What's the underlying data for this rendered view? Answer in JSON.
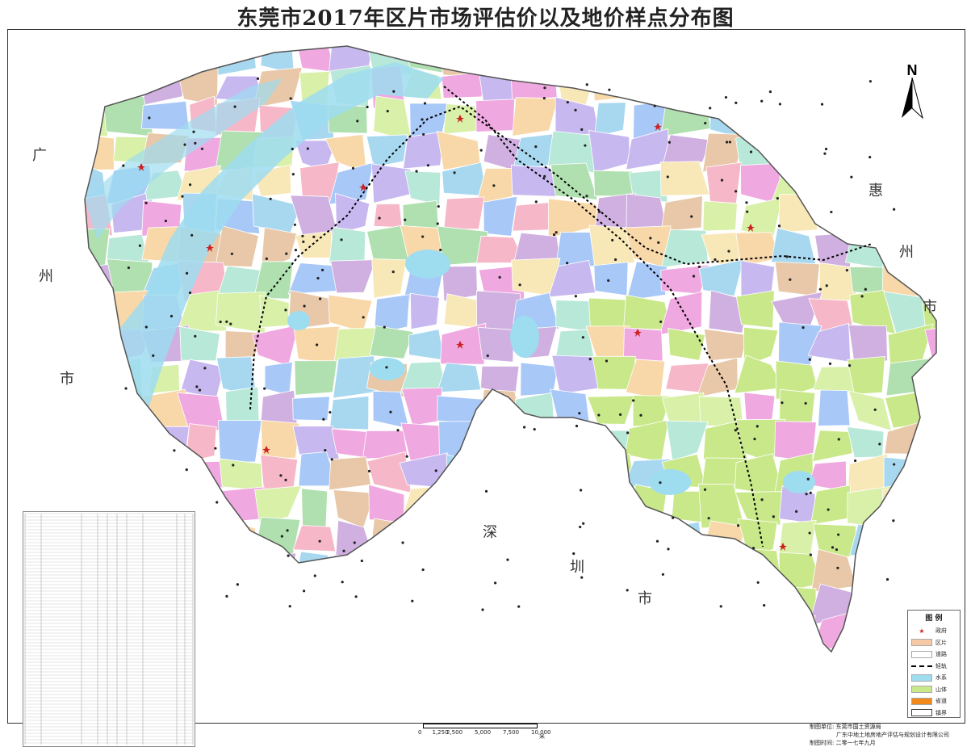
{
  "title": "东莞市2017年区片市场评估价以及地价样点分布图",
  "neighbors": {
    "guangzhou": [
      "广",
      "州",
      "市"
    ],
    "huizhou": [
      "惠",
      "州",
      "市"
    ],
    "shenzhen": [
      "深",
      "圳",
      "市"
    ]
  },
  "north_label": "N",
  "legend": {
    "title": "图 例",
    "items": [
      {
        "label": "政府",
        "icon": "star-icon",
        "color": "#cc2222"
      },
      {
        "label": "区片",
        "icon": "fill-swatch",
        "color": "#f6c8a6"
      },
      {
        "label": "道路",
        "icon": "fill-swatch",
        "color": "#ffffff"
      },
      {
        "label": "轻轨",
        "icon": "dashed-line",
        "color": "#000000"
      },
      {
        "label": "水系",
        "icon": "fill-swatch",
        "color": "#9edcf0"
      },
      {
        "label": "山体",
        "icon": "fill-swatch",
        "color": "#c9e88a"
      },
      {
        "label": "省道",
        "icon": "fill-swatch",
        "color": "#f08a1c"
      },
      {
        "label": "镇界",
        "icon": "boundary-swatch",
        "color": "#ffffff"
      }
    ]
  },
  "scale_bar": {
    "ticks": [
      "0",
      "1,250",
      "2,500",
      "5,000",
      "7,500",
      "10,000"
    ],
    "unit": "米"
  },
  "credits": {
    "unit_label": "制图单位:",
    "units": [
      "东莞市国土资源局",
      "广东中地土地房地产评估与规划设计有限公司"
    ],
    "time_label": "制图时间:",
    "time": "二零一七年九月"
  },
  "palette": {
    "water": "#9edcf0",
    "mountain": "#c9e88a",
    "rail": "#000000",
    "district_colors": [
      "#f6b8c8",
      "#c8b8f0",
      "#a8d8f0",
      "#f8d8a8",
      "#d8f0a8",
      "#f0a8e0",
      "#b8e8d8",
      "#e8c8a8",
      "#a8c8f8",
      "#f8e8b8",
      "#d0b0e0",
      "#b0e0b0"
    ]
  }
}
